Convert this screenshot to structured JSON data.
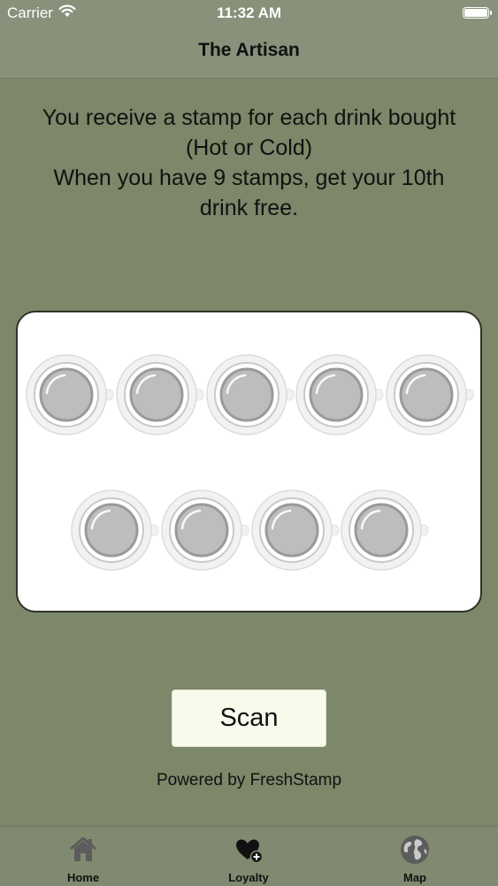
{
  "status_bar": {
    "carrier": "Carrier",
    "time": "11:32 AM"
  },
  "nav": {
    "title": "The Artisan"
  },
  "info": {
    "lines": [
      "You receive a stamp for each drink bought",
      "(Hot or Cold)",
      "When you have 9 stamps, get your 10th",
      "drink free."
    ]
  },
  "stamp_card": {
    "stamp_count": 9,
    "stamped_count": 0,
    "cup_icon": "coffee-cup-icon"
  },
  "scan_button": {
    "label": "Scan"
  },
  "footer": {
    "powered_by": "Powered by FreshStamp"
  },
  "tabs": [
    {
      "label": "Home",
      "icon": "home-icon"
    },
    {
      "label": "Loyalty",
      "icon": "heart-plus-icon"
    },
    {
      "label": "Map",
      "icon": "globe-icon"
    }
  ],
  "colors": {
    "background": "#7d8769",
    "bar": "#88917a",
    "card": "#ffffff",
    "scan_button": "#f8fbec"
  }
}
